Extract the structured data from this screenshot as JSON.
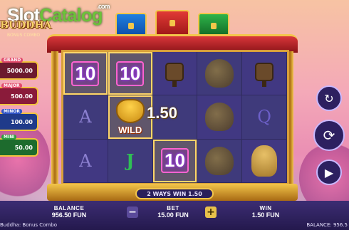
{
  "watermark": {
    "slot": "Slot",
    "catalog": "Catalog",
    "com": ".com"
  },
  "logo": {
    "title": "BUDDHA",
    "subtitle": "BONUS COMBO"
  },
  "jackpots": [
    {
      "label": "GRAND",
      "value": "5000.00"
    },
    {
      "label": "MAJOR",
      "value": "500.00"
    },
    {
      "label": "MINOR",
      "value": "100.00"
    },
    {
      "label": "MINI",
      "value": "50.00"
    }
  ],
  "reels": [
    [
      "10",
      "10",
      "lantern",
      "tree",
      "lantern"
    ],
    [
      "A",
      "WILD",
      "1.50",
      "tree",
      "Q"
    ],
    [
      "A",
      "J",
      "10",
      "tree",
      "buddha"
    ]
  ],
  "symbols": {
    "wild": "WILD"
  },
  "win_amount": "1.50",
  "ways_win": "2 WAYS WIN 1.50",
  "bottom": {
    "balance_label": "BALANCE",
    "balance_value": "956.50 FUN",
    "bet_label": "BET",
    "bet_value": "15.00 FUN",
    "win_label": "WIN",
    "win_value": "1.50 FUN",
    "minus": "−",
    "plus": "+"
  },
  "footer": {
    "game_name": "Buddha: Bonus Combo",
    "balance_short": "BALANCE: 956.5"
  },
  "buttons": {
    "refresh": "↻",
    "spin": "⟳",
    "autoplay": "▶"
  }
}
